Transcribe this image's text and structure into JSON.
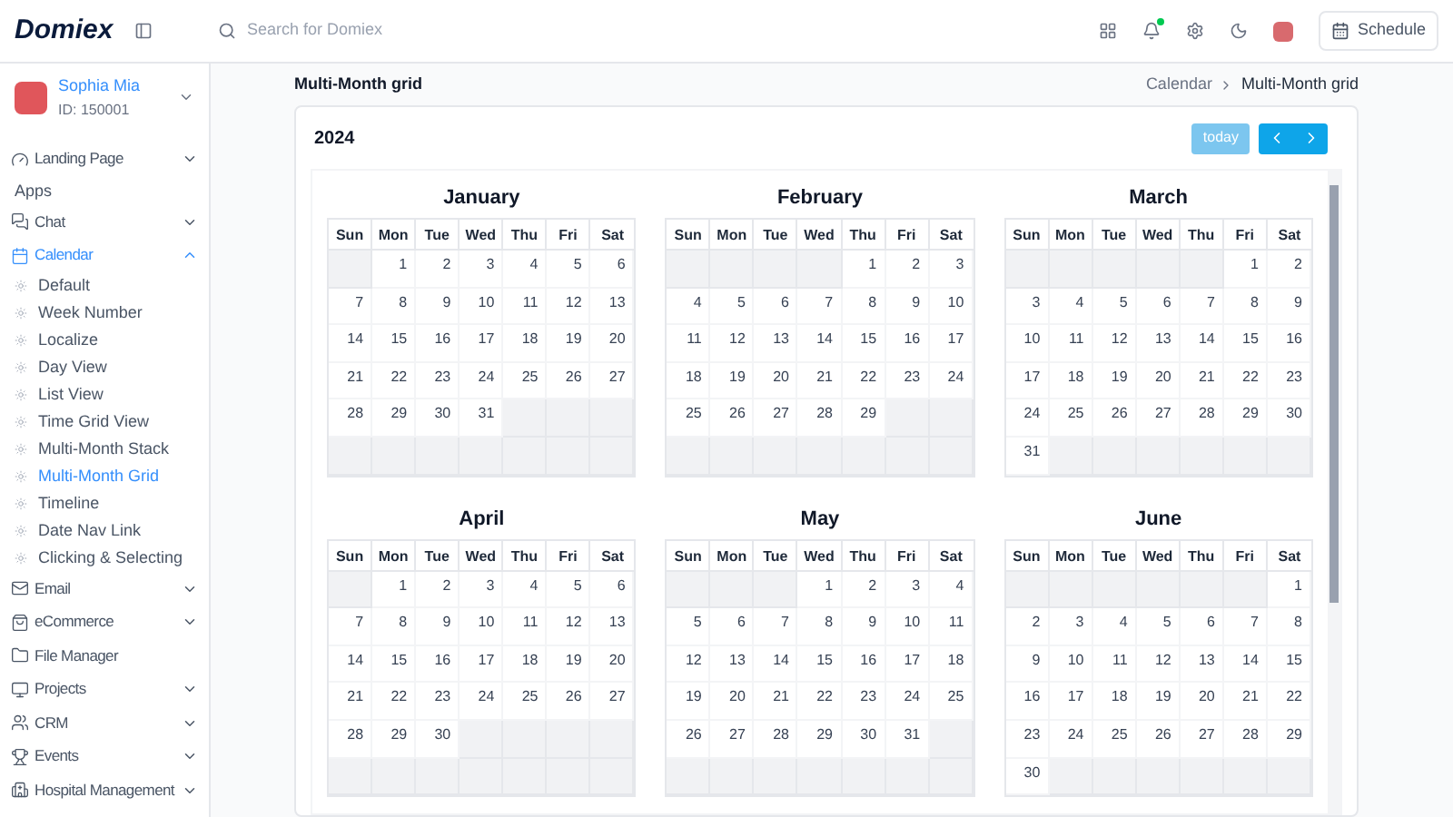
{
  "header": {
    "logo": "Domiex",
    "search": {
      "placeholder": "Search for Domiex"
    },
    "notification_dot": true,
    "schedule_button": "Schedule"
  },
  "user": {
    "name": "Sophia Mia",
    "id": "ID: 150001"
  },
  "sidebar": {
    "items": [
      {
        "kind": "group",
        "label": "Landing Page",
        "expanded": false,
        "selected": false
      },
      {
        "kind": "heading",
        "label": "Apps"
      },
      {
        "kind": "group",
        "label": "Chat",
        "expanded": false,
        "selected": false
      },
      {
        "kind": "group",
        "label": "Calendar",
        "expanded": true,
        "selected": true,
        "children": [
          {
            "label": "Default",
            "selected": false
          },
          {
            "label": "Week Number",
            "selected": false
          },
          {
            "label": "Localize",
            "selected": false
          },
          {
            "label": "Day View",
            "selected": false
          },
          {
            "label": "List View",
            "selected": false
          },
          {
            "label": "Time Grid View",
            "selected": false
          },
          {
            "label": "Multi-Month Stack",
            "selected": false
          },
          {
            "label": "Multi-Month Grid",
            "selected": true
          },
          {
            "label": "Timeline",
            "selected": false
          },
          {
            "label": "Date Nav Link",
            "selected": false
          },
          {
            "label": "Clicking & Selecting",
            "selected": false
          }
        ]
      },
      {
        "kind": "group",
        "label": "Email",
        "expanded": false,
        "selected": false
      },
      {
        "kind": "group",
        "label": "eCommerce",
        "expanded": false,
        "selected": false
      },
      {
        "kind": "link",
        "label": "File Manager",
        "selected": false
      },
      {
        "kind": "group",
        "label": "Projects",
        "expanded": false,
        "selected": false
      },
      {
        "kind": "group",
        "label": "CRM",
        "expanded": false,
        "selected": false
      },
      {
        "kind": "group",
        "label": "Events",
        "expanded": false,
        "selected": false
      },
      {
        "kind": "group",
        "label": "Hospital Management",
        "expanded": false,
        "selected": false
      }
    ]
  },
  "page_title": "Multi-Month grid",
  "breadcrumb": [
    "Calendar",
    "Multi-Month grid"
  ],
  "calendar": {
    "year": "2024",
    "today_button": {
      "label": "today",
      "disabled": true
    },
    "months": [
      {
        "name": "January",
        "weekdays": [
          "Sun",
          "Mon",
          "Tue",
          "Wed",
          "Thu",
          "Fri",
          "Sat"
        ],
        "weeks": [
          [
            {
              "kind": "blank"
            },
            {
              "kind": "day",
              "text": "1"
            },
            {
              "kind": "day",
              "text": "2"
            },
            {
              "kind": "day",
              "text": "3"
            },
            {
              "kind": "day",
              "text": "4"
            },
            {
              "kind": "day",
              "text": "5"
            },
            {
              "kind": "day",
              "text": "6"
            }
          ],
          [
            {
              "kind": "day",
              "text": "7"
            },
            {
              "kind": "day",
              "text": "8"
            },
            {
              "kind": "day",
              "text": "9"
            },
            {
              "kind": "day",
              "text": "10"
            },
            {
              "kind": "day",
              "text": "11"
            },
            {
              "kind": "day",
              "text": "12"
            },
            {
              "kind": "day",
              "text": "13"
            }
          ],
          [
            {
              "kind": "day",
              "text": "14"
            },
            {
              "kind": "day",
              "text": "15"
            },
            {
              "kind": "day",
              "text": "16"
            },
            {
              "kind": "day",
              "text": "17"
            },
            {
              "kind": "day",
              "text": "18"
            },
            {
              "kind": "day",
              "text": "19"
            },
            {
              "kind": "day",
              "text": "20"
            }
          ],
          [
            {
              "kind": "day",
              "text": "21"
            },
            {
              "kind": "day",
              "text": "22"
            },
            {
              "kind": "day",
              "text": "23"
            },
            {
              "kind": "day",
              "text": "24"
            },
            {
              "kind": "day",
              "text": "25"
            },
            {
              "kind": "day",
              "text": "26"
            },
            {
              "kind": "day",
              "text": "27"
            }
          ],
          [
            {
              "kind": "day",
              "text": "28"
            },
            {
              "kind": "day",
              "text": "29"
            },
            {
              "kind": "day",
              "text": "30"
            },
            {
              "kind": "day",
              "text": "31"
            },
            {
              "kind": "blank"
            },
            {
              "kind": "blank"
            },
            {
              "kind": "blank"
            }
          ],
          [
            {
              "kind": "blank"
            },
            {
              "kind": "blank"
            },
            {
              "kind": "blank"
            },
            {
              "kind": "blank"
            },
            {
              "kind": "blank"
            },
            {
              "kind": "blank"
            },
            {
              "kind": "blank"
            }
          ]
        ]
      },
      {
        "name": "February",
        "weekdays": [
          "Sun",
          "Mon",
          "Tue",
          "Wed",
          "Thu",
          "Fri",
          "Sat"
        ],
        "weeks": [
          [
            {
              "kind": "blank"
            },
            {
              "kind": "blank"
            },
            {
              "kind": "blank"
            },
            {
              "kind": "blank"
            },
            {
              "kind": "day",
              "text": "1"
            },
            {
              "kind": "day",
              "text": "2"
            },
            {
              "kind": "day",
              "text": "3"
            }
          ],
          [
            {
              "kind": "day",
              "text": "4"
            },
            {
              "kind": "day",
              "text": "5"
            },
            {
              "kind": "day",
              "text": "6"
            },
            {
              "kind": "day",
              "text": "7"
            },
            {
              "kind": "day",
              "text": "8"
            },
            {
              "kind": "day",
              "text": "9"
            },
            {
              "kind": "day",
              "text": "10"
            }
          ],
          [
            {
              "kind": "day",
              "text": "11"
            },
            {
              "kind": "day",
              "text": "12"
            },
            {
              "kind": "day",
              "text": "13"
            },
            {
              "kind": "day",
              "text": "14"
            },
            {
              "kind": "day",
              "text": "15"
            },
            {
              "kind": "day",
              "text": "16"
            },
            {
              "kind": "day",
              "text": "17"
            }
          ],
          [
            {
              "kind": "day",
              "text": "18"
            },
            {
              "kind": "day",
              "text": "19"
            },
            {
              "kind": "day",
              "text": "20"
            },
            {
              "kind": "day",
              "text": "21"
            },
            {
              "kind": "day",
              "text": "22"
            },
            {
              "kind": "day",
              "text": "23"
            },
            {
              "kind": "day",
              "text": "24"
            }
          ],
          [
            {
              "kind": "day",
              "text": "25"
            },
            {
              "kind": "day",
              "text": "26"
            },
            {
              "kind": "day",
              "text": "27"
            },
            {
              "kind": "day",
              "text": "28"
            },
            {
              "kind": "day",
              "text": "29"
            },
            {
              "kind": "blank"
            },
            {
              "kind": "blank"
            }
          ],
          [
            {
              "kind": "blank"
            },
            {
              "kind": "blank"
            },
            {
              "kind": "blank"
            },
            {
              "kind": "blank"
            },
            {
              "kind": "blank"
            },
            {
              "kind": "blank"
            },
            {
              "kind": "blank"
            }
          ]
        ]
      },
      {
        "name": "March",
        "weekdays": [
          "Sun",
          "Mon",
          "Tue",
          "Wed",
          "Thu",
          "Fri",
          "Sat"
        ],
        "weeks": [
          [
            {
              "kind": "blank"
            },
            {
              "kind": "blank"
            },
            {
              "kind": "blank"
            },
            {
              "kind": "blank"
            },
            {
              "kind": "blank"
            },
            {
              "kind": "day",
              "text": "1"
            },
            {
              "kind": "day",
              "text": "2"
            }
          ],
          [
            {
              "kind": "day",
              "text": "3"
            },
            {
              "kind": "day",
              "text": "4"
            },
            {
              "kind": "day",
              "text": "5"
            },
            {
              "kind": "day",
              "text": "6"
            },
            {
              "kind": "day",
              "text": "7"
            },
            {
              "kind": "day",
              "text": "8"
            },
            {
              "kind": "day",
              "text": "9"
            }
          ],
          [
            {
              "kind": "day",
              "text": "10"
            },
            {
              "kind": "day",
              "text": "11"
            },
            {
              "kind": "day",
              "text": "12"
            },
            {
              "kind": "day",
              "text": "13"
            },
            {
              "kind": "day",
              "text": "14"
            },
            {
              "kind": "day",
              "text": "15"
            },
            {
              "kind": "day",
              "text": "16"
            }
          ],
          [
            {
              "kind": "day",
              "text": "17"
            },
            {
              "kind": "day",
              "text": "18"
            },
            {
              "kind": "day",
              "text": "19"
            },
            {
              "kind": "day",
              "text": "20"
            },
            {
              "kind": "day",
              "text": "21"
            },
            {
              "kind": "day",
              "text": "22"
            },
            {
              "kind": "day",
              "text": "23"
            }
          ],
          [
            {
              "kind": "day",
              "text": "24"
            },
            {
              "kind": "day",
              "text": "25"
            },
            {
              "kind": "day",
              "text": "26"
            },
            {
              "kind": "day",
              "text": "27"
            },
            {
              "kind": "day",
              "text": "28"
            },
            {
              "kind": "day",
              "text": "29"
            },
            {
              "kind": "day",
              "text": "30"
            }
          ],
          [
            {
              "kind": "day",
              "text": "31"
            },
            {
              "kind": "blank"
            },
            {
              "kind": "blank"
            },
            {
              "kind": "blank"
            },
            {
              "kind": "blank"
            },
            {
              "kind": "blank"
            },
            {
              "kind": "blank"
            }
          ]
        ]
      },
      {
        "name": "April",
        "weekdays": [
          "Sun",
          "Mon",
          "Tue",
          "Wed",
          "Thu",
          "Fri",
          "Sat"
        ],
        "weeks": [
          [
            {
              "kind": "blank"
            },
            {
              "kind": "day",
              "text": "1"
            },
            {
              "kind": "day",
              "text": "2"
            },
            {
              "kind": "day",
              "text": "3"
            },
            {
              "kind": "day",
              "text": "4"
            },
            {
              "kind": "day",
              "text": "5"
            },
            {
              "kind": "day",
              "text": "6"
            }
          ],
          [
            {
              "kind": "day",
              "text": "7"
            },
            {
              "kind": "day",
              "text": "8"
            },
            {
              "kind": "day",
              "text": "9"
            },
            {
              "kind": "day",
              "text": "10"
            },
            {
              "kind": "day",
              "text": "11"
            },
            {
              "kind": "day",
              "text": "12"
            },
            {
              "kind": "day",
              "text": "13"
            }
          ],
          [
            {
              "kind": "day",
              "text": "14"
            },
            {
              "kind": "day",
              "text": "15"
            },
            {
              "kind": "day",
              "text": "16"
            },
            {
              "kind": "day",
              "text": "17"
            },
            {
              "kind": "day",
              "text": "18"
            },
            {
              "kind": "day",
              "text": "19"
            },
            {
              "kind": "day",
              "text": "20"
            }
          ],
          [
            {
              "kind": "day",
              "text": "21"
            },
            {
              "kind": "day",
              "text": "22"
            },
            {
              "kind": "day",
              "text": "23"
            },
            {
              "kind": "day",
              "text": "24"
            },
            {
              "kind": "day",
              "text": "25"
            },
            {
              "kind": "day",
              "text": "26"
            },
            {
              "kind": "day",
              "text": "27"
            }
          ],
          [
            {
              "kind": "day",
              "text": "28"
            },
            {
              "kind": "day",
              "text": "29"
            },
            {
              "kind": "day",
              "text": "30"
            },
            {
              "kind": "blank"
            },
            {
              "kind": "blank"
            },
            {
              "kind": "blank"
            },
            {
              "kind": "blank"
            }
          ],
          [
            {
              "kind": "blank"
            },
            {
              "kind": "blank"
            },
            {
              "kind": "blank"
            },
            {
              "kind": "blank"
            },
            {
              "kind": "blank"
            },
            {
              "kind": "blank"
            },
            {
              "kind": "blank"
            }
          ]
        ]
      },
      {
        "name": "May",
        "weekdays": [
          "Sun",
          "Mon",
          "Tue",
          "Wed",
          "Thu",
          "Fri",
          "Sat"
        ],
        "weeks": [
          [
            {
              "kind": "blank"
            },
            {
              "kind": "blank"
            },
            {
              "kind": "blank"
            },
            {
              "kind": "day",
              "text": "1"
            },
            {
              "kind": "day",
              "text": "2"
            },
            {
              "kind": "day",
              "text": "3"
            },
            {
              "kind": "day",
              "text": "4"
            }
          ],
          [
            {
              "kind": "day",
              "text": "5"
            },
            {
              "kind": "day",
              "text": "6"
            },
            {
              "kind": "day",
              "text": "7"
            },
            {
              "kind": "day",
              "text": "8"
            },
            {
              "kind": "day",
              "text": "9"
            },
            {
              "kind": "day",
              "text": "10"
            },
            {
              "kind": "day",
              "text": "11"
            }
          ],
          [
            {
              "kind": "day",
              "text": "12"
            },
            {
              "kind": "day",
              "text": "13"
            },
            {
              "kind": "day",
              "text": "14"
            },
            {
              "kind": "day",
              "text": "15"
            },
            {
              "kind": "day",
              "text": "16"
            },
            {
              "kind": "day",
              "text": "17"
            },
            {
              "kind": "day",
              "text": "18"
            }
          ],
          [
            {
              "kind": "day",
              "text": "19"
            },
            {
              "kind": "day",
              "text": "20"
            },
            {
              "kind": "day",
              "text": "21"
            },
            {
              "kind": "day",
              "text": "22"
            },
            {
              "kind": "day",
              "text": "23"
            },
            {
              "kind": "day",
              "text": "24"
            },
            {
              "kind": "day",
              "text": "25"
            }
          ],
          [
            {
              "kind": "day",
              "text": "26"
            },
            {
              "kind": "day",
              "text": "27"
            },
            {
              "kind": "day",
              "text": "28"
            },
            {
              "kind": "day",
              "text": "29"
            },
            {
              "kind": "day",
              "text": "30"
            },
            {
              "kind": "day",
              "text": "31"
            },
            {
              "kind": "blank"
            }
          ],
          [
            {
              "kind": "blank"
            },
            {
              "kind": "blank"
            },
            {
              "kind": "blank"
            },
            {
              "kind": "blank"
            },
            {
              "kind": "blank"
            },
            {
              "kind": "blank"
            },
            {
              "kind": "blank"
            }
          ]
        ]
      },
      {
        "name": "June",
        "weekdays": [
          "Sun",
          "Mon",
          "Tue",
          "Wed",
          "Thu",
          "Fri",
          "Sat"
        ],
        "weeks": [
          [
            {
              "kind": "blank"
            },
            {
              "kind": "blank"
            },
            {
              "kind": "blank"
            },
            {
              "kind": "blank"
            },
            {
              "kind": "blank"
            },
            {
              "kind": "blank"
            },
            {
              "kind": "day",
              "text": "1"
            }
          ],
          [
            {
              "kind": "day",
              "text": "2"
            },
            {
              "kind": "day",
              "text": "3"
            },
            {
              "kind": "day",
              "text": "4"
            },
            {
              "kind": "day",
              "text": "5"
            },
            {
              "kind": "day",
              "text": "6"
            },
            {
              "kind": "day",
              "text": "7"
            },
            {
              "kind": "day",
              "text": "8"
            }
          ],
          [
            {
              "kind": "day",
              "text": "9"
            },
            {
              "kind": "day",
              "text": "10"
            },
            {
              "kind": "day",
              "text": "11"
            },
            {
              "kind": "day",
              "text": "12"
            },
            {
              "kind": "day",
              "text": "13"
            },
            {
              "kind": "day",
              "text": "14"
            },
            {
              "kind": "day",
              "text": "15"
            }
          ],
          [
            {
              "kind": "day",
              "text": "16"
            },
            {
              "kind": "day",
              "text": "17"
            },
            {
              "kind": "day",
              "text": "18"
            },
            {
              "kind": "day",
              "text": "19"
            },
            {
              "kind": "day",
              "text": "20"
            },
            {
              "kind": "day",
              "text": "21"
            },
            {
              "kind": "day",
              "text": "22"
            }
          ],
          [
            {
              "kind": "day",
              "text": "23"
            },
            {
              "kind": "day",
              "text": "24"
            },
            {
              "kind": "day",
              "text": "25"
            },
            {
              "kind": "day",
              "text": "26"
            },
            {
              "kind": "day",
              "text": "27"
            },
            {
              "kind": "day",
              "text": "28"
            },
            {
              "kind": "day",
              "text": "29"
            }
          ],
          [
            {
              "kind": "day",
              "text": "30"
            },
            {
              "kind": "blank"
            },
            {
              "kind": "blank"
            },
            {
              "kind": "blank"
            },
            {
              "kind": "blank"
            },
            {
              "kind": "blank"
            },
            {
              "kind": "blank"
            }
          ]
        ]
      }
    ]
  }
}
